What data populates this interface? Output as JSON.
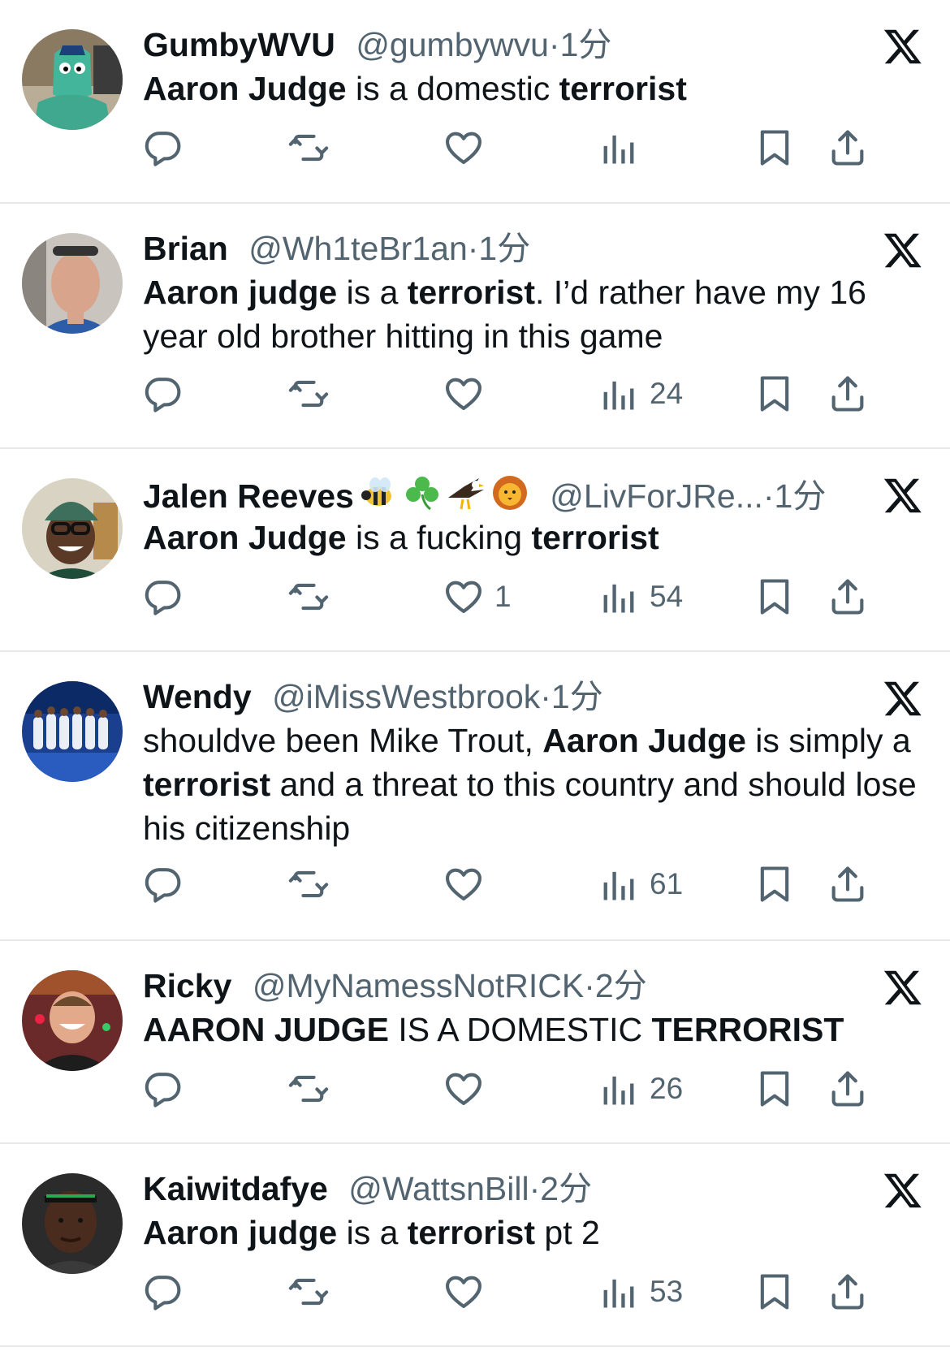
{
  "tweets": [
    {
      "name": "GumbyWVU",
      "handle": "@gumbywvu",
      "sep": "·",
      "time": "1分",
      "text": [
        {
          "t": "Aaron Judge",
          "b": true
        },
        {
          "t": " is a domestic ",
          "b": false
        },
        {
          "t": "terrorist",
          "b": true
        }
      ],
      "reply_count": "",
      "retweet_count": "",
      "like_count": "",
      "view_count": "",
      "avatar_icon": "gumby-avatar"
    },
    {
      "name": "Brian",
      "handle": "@Wh1teBr1an",
      "sep": "·",
      "time": "1分",
      "text": [
        {
          "t": "Aaron judge",
          "b": true
        },
        {
          "t": " is a ",
          "b": false
        },
        {
          "t": "terrorist",
          "b": true
        },
        {
          "t": ". I’d rather have my 16 year old brother hitting in this game",
          "b": false
        }
      ],
      "reply_count": "",
      "retweet_count": "",
      "like_count": "",
      "view_count": "24",
      "avatar_icon": "man-sunglasses-avatar"
    },
    {
      "name": "Jalen Reeves",
      "handle": "@LivForJRe...",
      "sep": "·",
      "time": "1分",
      "emojis": [
        "bee-emoji",
        "shamrock-emoji",
        "eagle-emoji",
        "lion-emoji"
      ],
      "text": [
        {
          "t": "Aaron Judge",
          "b": true
        },
        {
          "t": " is a fucking ",
          "b": false
        },
        {
          "t": "terrorist",
          "b": true
        }
      ],
      "reply_count": "",
      "retweet_count": "",
      "like_count": "1",
      "view_count": "54",
      "avatar_icon": "man-beanie-avatar"
    },
    {
      "name": "Wendy",
      "handle": "@iMissWestbrook",
      "sep": "·",
      "time": "1分",
      "text": [
        {
          "t": "shouldve been Mike Trout, ",
          "b": false
        },
        {
          "t": "Aaron Judge",
          "b": true
        },
        {
          "t": " is simply a ",
          "b": false
        },
        {
          "t": "terrorist",
          "b": true
        },
        {
          "t": " and a threat to this country and should lose his citizenship",
          "b": false
        }
      ],
      "reply_count": "",
      "retweet_count": "",
      "like_count": "",
      "view_count": "61",
      "avatar_icon": "team-photo-avatar"
    },
    {
      "name": "Ricky",
      "handle": "@MyNamessNotRICK",
      "sep": "·",
      "time": "2分",
      "text": [
        {
          "t": "AARON JUDGE",
          "b": true
        },
        {
          "t": " IS A DOMESTIC ",
          "b": false
        },
        {
          "t": "TERRORIST",
          "b": true
        }
      ],
      "reply_count": "",
      "retweet_count": "",
      "like_count": "",
      "view_count": "26",
      "avatar_icon": "man-smiling-avatar"
    },
    {
      "name": "Kaiwitdafye",
      "handle": "@WattsnBill",
      "sep": "·",
      "time": "2分",
      "text": [
        {
          "t": "Aaron judge",
          "b": true
        },
        {
          "t": " is a ",
          "b": false
        },
        {
          "t": "terrorist",
          "b": true
        },
        {
          "t": " pt 2",
          "b": false
        }
      ],
      "reply_count": "",
      "retweet_count": "",
      "like_count": "",
      "view_count": "53",
      "avatar_icon": "athlete-avatar"
    }
  ],
  "icons": {
    "reply": "reply-icon",
    "retweet": "retweet-icon",
    "like": "heart-icon",
    "views": "views-icon",
    "bookmark": "bookmark-icon",
    "share": "share-icon",
    "logo": "x-logo-icon"
  },
  "colors": {
    "text": "#0f1419",
    "muted": "#536471",
    "divider": "#e6e8ea"
  }
}
